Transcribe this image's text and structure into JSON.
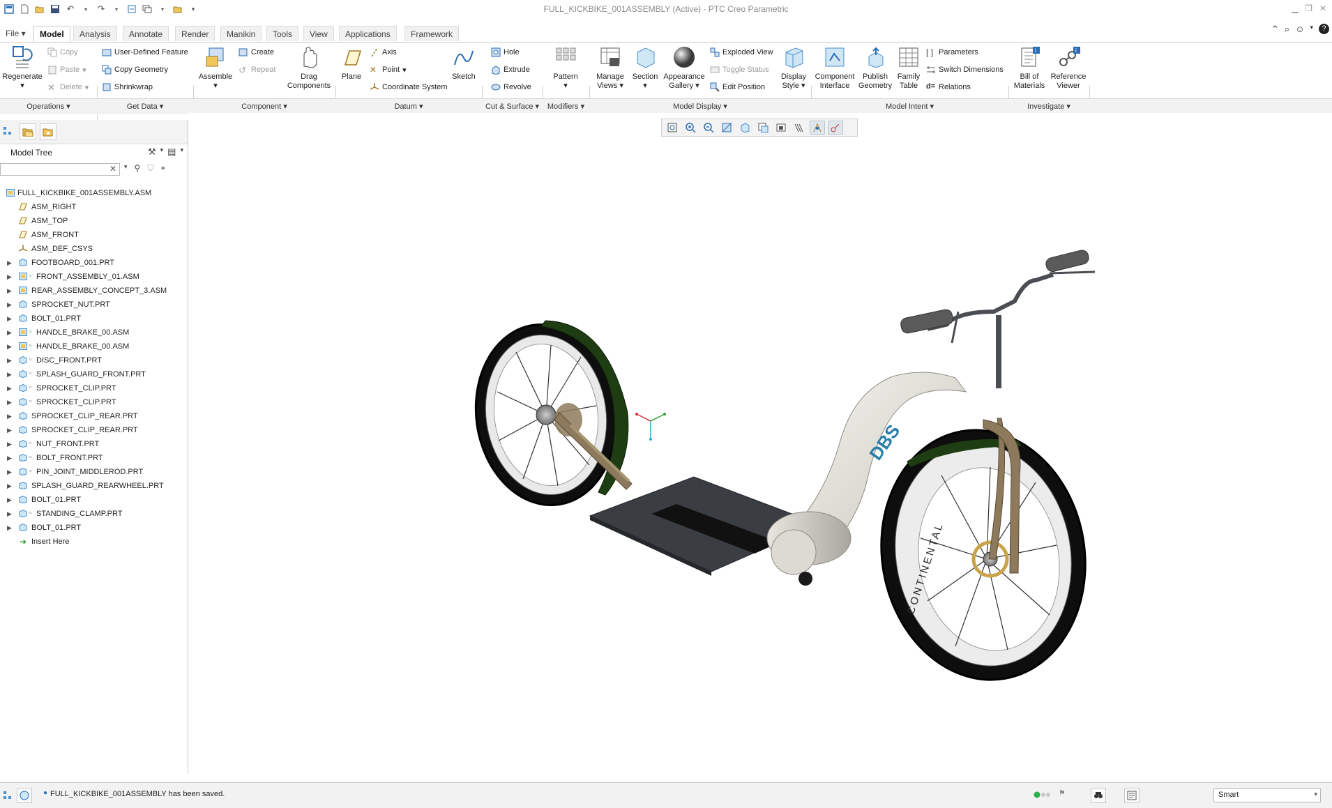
{
  "window": {
    "title": "FULL_KICKBIKE_001ASSEMBLY (Active) - PTC Creo Parametric"
  },
  "tabs": [
    {
      "label": "File",
      "has_menu": true
    },
    {
      "label": "Model",
      "active": true
    },
    {
      "label": "Analysis"
    },
    {
      "label": "Annotate"
    },
    {
      "label": "Render"
    },
    {
      "label": "Manikin"
    },
    {
      "label": "Tools"
    },
    {
      "label": "View"
    },
    {
      "label": "Applications"
    },
    {
      "label": "Framework"
    }
  ],
  "ribbon": {
    "operations": {
      "regenerate": "Regenerate",
      "copy": "Copy",
      "paste": "Paste",
      "delete": "Delete"
    },
    "get_data": {
      "user_defined_feature": "User-Defined Feature",
      "copy_geometry": "Copy Geometry",
      "shrinkwrap": "Shrinkwrap"
    },
    "component": {
      "assemble": "Assemble",
      "create": "Create",
      "repeat": "Repeat",
      "drag_components_l1": "Drag",
      "drag_components_l2": "Components"
    },
    "datum": {
      "plane": "Plane",
      "axis": "Axis",
      "point": "Point",
      "coordinate_system": "Coordinate System",
      "sketch": "Sketch"
    },
    "cut_surface": {
      "hole": "Hole",
      "extrude": "Extrude",
      "revolve": "Revolve"
    },
    "modifiers": {
      "pattern": "Pattern"
    },
    "model_display": {
      "manage_views_l1": "Manage",
      "manage_views_l2": "Views",
      "section": "Section",
      "appearance_gallery_l1": "Appearance",
      "appearance_gallery_l2": "Gallery",
      "exploded_view": "Exploded View",
      "toggle_status": "Toggle Status",
      "edit_position": "Edit Position",
      "display_style_l1": "Display",
      "display_style_l2": "Style"
    },
    "model_intent": {
      "component_interface_l1": "Component",
      "component_interface_l2": "Interface",
      "publish_geometry_l1": "Publish",
      "publish_geometry_l2": "Geometry",
      "family_table_l1": "Family",
      "family_table_l2": "Table",
      "parameters": "Parameters",
      "switch_dimensions": "Switch Dimensions",
      "relations": "Relations"
    },
    "investigate": {
      "bill_of_materials_l1": "Bill of",
      "bill_of_materials_l2": "Materials",
      "reference_viewer_l1": "Reference",
      "reference_viewer_l2": "Viewer"
    },
    "groups": [
      {
        "label": "Operations"
      },
      {
        "label": "Get Data"
      },
      {
        "label": "Component"
      },
      {
        "label": "Datum"
      },
      {
        "label": "Cut & Surface"
      },
      {
        "label": "Modifiers"
      },
      {
        "label": "Model Display"
      },
      {
        "label": "Model Intent"
      },
      {
        "label": "Investigate"
      }
    ]
  },
  "model_tree": {
    "title": "Model Tree",
    "search_value": "",
    "root": "FULL_KICKBIKE_001ASSEMBLY.ASM",
    "items": [
      {
        "label": "ASM_RIGHT",
        "type": "datum-plane"
      },
      {
        "label": "ASM_TOP",
        "type": "datum-plane"
      },
      {
        "label": "ASM_FRONT",
        "type": "datum-plane"
      },
      {
        "label": "ASM_DEF_CSYS",
        "type": "csys"
      },
      {
        "label": "FOOTBOARD_001.PRT",
        "type": "part",
        "expandable": true
      },
      {
        "label": "FRONT_ASSEMBLY_01.ASM",
        "type": "asm-flex",
        "expandable": true
      },
      {
        "label": "REAR_ASSEMBLY_CONCEPT_3.ASM",
        "type": "asm",
        "expandable": true
      },
      {
        "label": "SPROCKET_NUT.PRT",
        "type": "part",
        "expandable": true
      },
      {
        "label": "BOLT_01.PRT",
        "type": "part",
        "expandable": true
      },
      {
        "label": "HANDLE_BRAKE_00.ASM",
        "type": "asm-flex",
        "expandable": true
      },
      {
        "label": "HANDLE_BRAKE_00.ASM",
        "type": "asm-flex",
        "expandable": true
      },
      {
        "label": "DISC_FRONT.PRT",
        "type": "part-flex",
        "expandable": true
      },
      {
        "label": "SPLASH_GUARD_FRONT.PRT",
        "type": "part-flex",
        "expandable": true
      },
      {
        "label": "SPROCKET_CLIP.PRT",
        "type": "part-flex",
        "expandable": true
      },
      {
        "label": "SPROCKET_CLIP.PRT",
        "type": "part-flex",
        "expandable": true
      },
      {
        "label": "SPROCKET_CLIP_REAR.PRT",
        "type": "part",
        "expandable": true
      },
      {
        "label": "SPROCKET_CLIP_REAR.PRT",
        "type": "part",
        "expandable": true
      },
      {
        "label": "NUT_FRONT.PRT",
        "type": "part-flex",
        "expandable": true
      },
      {
        "label": "BOLT_FRONT.PRT",
        "type": "part-flex",
        "expandable": true
      },
      {
        "label": "PIN_JOINT_MIDDLEROD.PRT",
        "type": "part-flex",
        "expandable": true
      },
      {
        "label": "SPLASH_GUARD_REARWHEEL.PRT",
        "type": "part",
        "expandable": true
      },
      {
        "label": "BOLT_01.PRT",
        "type": "part",
        "expandable": true
      },
      {
        "label": "STANDING_CLAMP.PRT",
        "type": "part-flex",
        "expandable": true
      },
      {
        "label": "BOLT_01.PRT",
        "type": "part",
        "expandable": true
      }
    ],
    "insert_here": "Insert Here"
  },
  "model": {
    "tire_brand": "CONTINENTAL",
    "frame_logo": "DBS"
  },
  "status": {
    "message": "FULL_KICKBIKE_001ASSEMBLY has been saved.",
    "selection_filter": "Smart"
  },
  "colors": {
    "accent": "#2a6db5",
    "tree_icon": "#4a8fd0",
    "fender_green": "#1f3d12",
    "frame_white": "#e8e6df",
    "frame_bronze": "#8d7a5c",
    "footboard": "#3a3d42",
    "status_green": "#2bb24c"
  }
}
